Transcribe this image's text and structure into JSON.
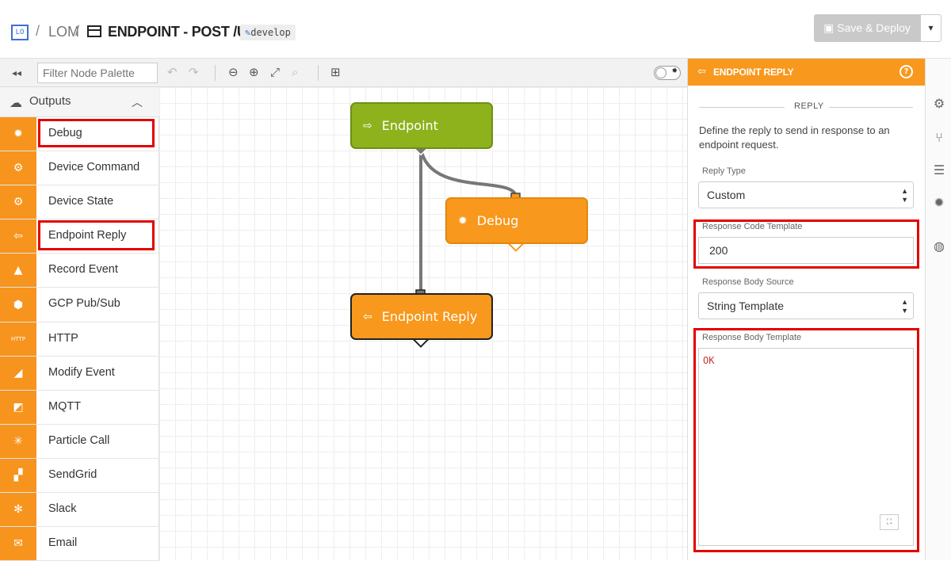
{
  "header": {
    "logo": "LO",
    "app_name": "LOM",
    "separator": "/",
    "flow_title": "ENDPOINT - POST /USERS",
    "branch": "develop",
    "save_label": "Save & Deploy",
    "save_caret": "▾"
  },
  "palette": {
    "collapse_label": "◂◂",
    "filter_placeholder": "Filter Node Palette",
    "category": "Outputs",
    "items": [
      {
        "label": "Debug",
        "icon": "bug-icon",
        "glyph": "✹"
      },
      {
        "label": "Device Command",
        "icon": "chip-icon",
        "glyph": "⚙"
      },
      {
        "label": "Device State",
        "icon": "chip-icon",
        "glyph": "⚙"
      },
      {
        "label": "Endpoint Reply",
        "icon": "reply-icon",
        "glyph": "⇦"
      },
      {
        "label": "Record Event",
        "icon": "event-icon",
        "glyph": "▲"
      },
      {
        "label": "GCP Pub/Sub",
        "icon": "gcp-icon",
        "glyph": "⬢"
      },
      {
        "label": "HTTP",
        "icon": "http-icon",
        "glyph": "HTTP"
      },
      {
        "label": "Modify Event",
        "icon": "modify-event-icon",
        "glyph": "◢"
      },
      {
        "label": "MQTT",
        "icon": "mqtt-icon",
        "glyph": "◩"
      },
      {
        "label": "Particle Call",
        "icon": "particle-icon",
        "glyph": "✳"
      },
      {
        "label": "SendGrid",
        "icon": "sendgrid-icon",
        "glyph": "▞"
      },
      {
        "label": "Slack",
        "icon": "slack-icon",
        "glyph": "✻"
      },
      {
        "label": "Email",
        "icon": "email-icon",
        "glyph": "✉"
      }
    ]
  },
  "canvas": {
    "nodes": {
      "endpoint": "Endpoint",
      "debug": "Debug",
      "reply": "Endpoint Reply"
    }
  },
  "panel": {
    "title": "ENDPOINT REPLY",
    "help": "?",
    "section": "REPLY",
    "description": "Define the reply to send in response to an endpoint request.",
    "reply_type_label": "Reply Type",
    "reply_type_value": "Custom",
    "response_code_label": "Response Code Template",
    "response_code_value": "200",
    "body_source_label": "Response Body Source",
    "body_source_value": "String Template",
    "body_template_label": "Response Body Template",
    "body_template_value": "OK"
  },
  "colors": {
    "accent_orange": "#f8981d",
    "endpoint_green": "#8db21c",
    "highlight_red": "#e20000"
  }
}
